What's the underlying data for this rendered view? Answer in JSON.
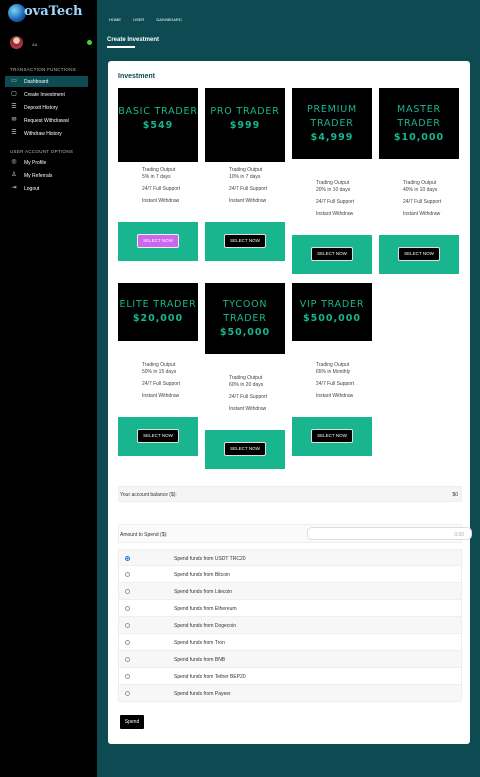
{
  "brand": {
    "logo_text": "ovaTech"
  },
  "user": {
    "name": "AA"
  },
  "sidebar": {
    "section1": "TRANSACTION FUNCTIONS",
    "section2": "USER ACCOUNT OPTIONS",
    "items": [
      {
        "label": "Dashboard",
        "icon": "dashboard-icon",
        "glyph": "▭"
      },
      {
        "label": "Create Investment",
        "icon": "folder-icon",
        "glyph": "▢"
      },
      {
        "label": "Deposit History",
        "icon": "list-icon",
        "glyph": "☰"
      },
      {
        "label": "Request Withdrawal",
        "icon": "envelope-icon",
        "glyph": "✉"
      },
      {
        "label": "Withdraw History",
        "icon": "list-icon",
        "glyph": "☰"
      },
      {
        "label": "My Profile",
        "icon": "user-circle-icon",
        "glyph": "◎"
      },
      {
        "label": "My Referrals",
        "icon": "users-icon",
        "glyph": "♙"
      },
      {
        "label": "Logout",
        "icon": "logout-icon",
        "glyph": "⇥"
      }
    ]
  },
  "breadcrumb": [
    "HOME",
    "USER",
    "DASHBOARD"
  ],
  "page_title": "Create Investment",
  "section_title": "Investment",
  "plans": [
    {
      "name1": "BASIC TRADER",
      "name2": "",
      "price": "$549",
      "output1": "Trading Output",
      "output2": "5% in 7 days",
      "support": "24/7 Full Support",
      "withdraw": "Instant Withdraw",
      "button": "SELECT NOW"
    },
    {
      "name1": "PRO TRADER",
      "name2": "",
      "price": "$999",
      "output1": "Trading Output",
      "output2": "10% in 7 days",
      "support": "24/7 Full Support",
      "withdraw": "Instant Withdraw",
      "button": "SELECT NOW"
    },
    {
      "name1": "PREMIUM",
      "name2": "TRADER",
      "price": "$4,999",
      "output1": "Trading Output",
      "output2": "20% in 10 days",
      "support": "24/7 Full Support",
      "withdraw": "Instant Withdraw",
      "button": "SELECT NOW"
    },
    {
      "name1": "MASTER",
      "name2": "TRADER",
      "price": "$10,000",
      "output1": "Trading Output",
      "output2": "40% in 10 days",
      "support": "24/7 Full Support",
      "withdraw": "Instant Withdraw",
      "button": "SELECT NOW"
    },
    {
      "name1": "ELITE TRADER",
      "name2": "",
      "price": "$20,000",
      "output1": "Trading Output",
      "output2": "50% in 15 days",
      "support": "24/7 Full Support",
      "withdraw": "Instant Withdraw",
      "button": "SELECT NOW"
    },
    {
      "name1": "TYCOON",
      "name2": "TRADER",
      "price": "$50,000",
      "output1": "Trading Output",
      "output2": "60% in 20 days",
      "support": "24/7 Full Support",
      "withdraw": "Instant Withdraw",
      "button": "SELECT NOW"
    },
    {
      "name1": "VIP TRADER",
      "name2": "",
      "price": "$500,000",
      "output1": "Trading Output",
      "output2": "65% in Monthly",
      "support": "24/7 Full Support",
      "withdraw": "Instant Withdraw",
      "button": "SELECT NOW"
    }
  ],
  "balance": {
    "label": "Your account balance ($):",
    "value": "$0"
  },
  "amount": {
    "label": "Amount to Spend ($):",
    "placeholder": "0.00"
  },
  "payment_options": [
    "Spend funds from USDT TRC20",
    "Spend funds from Bitcoin",
    "Spend funds from Litecoin",
    "Spend funds from Ethereum",
    "Spend funds from Dogecoin",
    "Spend funds from Tron",
    "Spend funds from BNB",
    "Spend funds from Tether BEP20",
    "Spend funds from Payeer"
  ],
  "selected_option": 0,
  "spend_button": "Spend",
  "colors": {
    "accent": "#19b58e",
    "header": "#0d4a52",
    "highlight_button": "#cc66ee"
  }
}
